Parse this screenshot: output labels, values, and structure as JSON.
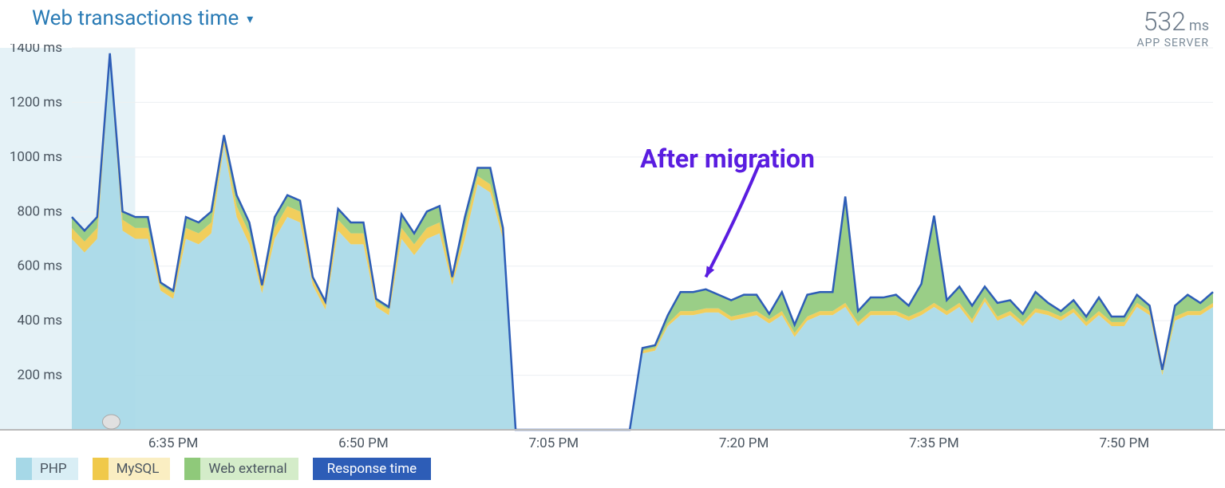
{
  "header": {
    "title": "Web transactions time",
    "stat_value": "532",
    "stat_unit": "ms",
    "stat_label": "APP SERVER"
  },
  "legend": {
    "php": "PHP",
    "mysql": "MySQL",
    "webext": "Web external",
    "resp": "Response time"
  },
  "annotation": "After migration",
  "chart_data": {
    "type": "area",
    "ylabel": "",
    "xlabel": "",
    "ylim": [
      0,
      1400
    ],
    "y_unit": "ms",
    "y_ticks": [
      200,
      400,
      600,
      800,
      1000,
      1200,
      1400
    ],
    "x_ticks": [
      "6:35 PM",
      "6:50 PM",
      "7:05 PM",
      "7:20 PM",
      "7:35 PM",
      "7:50 PM"
    ],
    "x_start": "6:27 PM",
    "x_end": "7:57 PM",
    "x_tick_indices": [
      8,
      23,
      38,
      53,
      68,
      83
    ],
    "categories_minutes_from_start": [
      0,
      1,
      2,
      3,
      4,
      5,
      6,
      7,
      8,
      9,
      10,
      11,
      12,
      13,
      14,
      15,
      16,
      17,
      18,
      19,
      20,
      21,
      22,
      23,
      24,
      25,
      26,
      27,
      28,
      29,
      30,
      31,
      32,
      33,
      34,
      35,
      36,
      37,
      38,
      39,
      40,
      41,
      42,
      43,
      44,
      45,
      46,
      47,
      48,
      49,
      50,
      51,
      52,
      53,
      54,
      55,
      56,
      57,
      58,
      59,
      60,
      61,
      62,
      63,
      64,
      65,
      66,
      67,
      68,
      69,
      70,
      71,
      72,
      73,
      74,
      75,
      76,
      77,
      78,
      79,
      80,
      81,
      82,
      83,
      84,
      85,
      86,
      87,
      88,
      89,
      90
    ],
    "series": [
      {
        "name": "PHP",
        "color": "#a6d8e7",
        "values": [
          700,
          650,
          700,
          1340,
          730,
          700,
          700,
          510,
          480,
          700,
          680,
          720,
          1040,
          780,
          680,
          500,
          700,
          780,
          760,
          530,
          440,
          730,
          680,
          680,
          450,
          420,
          700,
          640,
          700,
          720,
          530,
          700,
          900,
          870,
          700,
          0,
          0,
          0,
          0,
          0,
          0,
          0,
          0,
          0,
          0,
          280,
          290,
          380,
          420,
          420,
          430,
          430,
          400,
          410,
          420,
          390,
          420,
          340,
          400,
          420,
          420,
          450,
          380,
          420,
          420,
          420,
          400,
          420,
          450,
          420,
          450,
          390,
          470,
          400,
          420,
          380,
          430,
          420,
          400,
          430,
          380,
          420,
          380,
          380,
          450,
          420,
          200,
          400,
          420,
          420,
          450
        ]
      },
      {
        "name": "MySQL",
        "color": "#f0c94a",
        "values": [
          40,
          40,
          40,
          20,
          40,
          40,
          40,
          20,
          20,
          40,
          40,
          40,
          20,
          40,
          40,
          20,
          40,
          40,
          40,
          20,
          20,
          40,
          40,
          40,
          20,
          20,
          40,
          40,
          40,
          40,
          20,
          40,
          30,
          30,
          20,
          0,
          0,
          0,
          0,
          0,
          0,
          0,
          0,
          0,
          0,
          10,
          10,
          10,
          15,
          15,
          15,
          15,
          15,
          15,
          15,
          15,
          15,
          15,
          15,
          15,
          15,
          15,
          15,
          15,
          15,
          15,
          15,
          15,
          15,
          15,
          15,
          15,
          15,
          15,
          15,
          15,
          15,
          15,
          15,
          15,
          15,
          15,
          15,
          15,
          15,
          15,
          10,
          15,
          15,
          15,
          15
        ]
      },
      {
        "name": "Web external",
        "color": "#8fc97a",
        "values": [
          40,
          40,
          40,
          20,
          30,
          40,
          40,
          10,
          10,
          40,
          40,
          40,
          20,
          40,
          40,
          10,
          40,
          40,
          40,
          10,
          10,
          40,
          40,
          40,
          10,
          10,
          50,
          40,
          60,
          60,
          10,
          40,
          30,
          60,
          20,
          0,
          0,
          0,
          0,
          0,
          0,
          0,
          0,
          0,
          0,
          10,
          10,
          30,
          70,
          70,
          70,
          50,
          60,
          70,
          60,
          20,
          70,
          30,
          80,
          70,
          70,
          390,
          40,
          50,
          50,
          60,
          40,
          100,
          320,
          40,
          60,
          50,
          40,
          50,
          40,
          30,
          60,
          30,
          20,
          30,
          20,
          50,
          20,
          20,
          30,
          20,
          10,
          40,
          60,
          30,
          40
        ]
      }
    ],
    "response_time": {
      "name": "Response time",
      "color": "#2d5db7",
      "values": [
        780,
        730,
        780,
        1380,
        800,
        780,
        780,
        540,
        510,
        780,
        760,
        800,
        1080,
        860,
        760,
        530,
        780,
        860,
        840,
        560,
        470,
        810,
        760,
        760,
        480,
        450,
        790,
        720,
        800,
        820,
        560,
        780,
        960,
        960,
        740,
        0,
        0,
        0,
        0,
        0,
        0,
        0,
        0,
        0,
        0,
        300,
        310,
        420,
        505,
        505,
        515,
        495,
        475,
        495,
        495,
        425,
        505,
        385,
        495,
        505,
        505,
        855,
        435,
        485,
        485,
        495,
        455,
        535,
        785,
        475,
        525,
        455,
        525,
        465,
        475,
        425,
        505,
        465,
        435,
        475,
        415,
        485,
        415,
        415,
        495,
        455,
        220,
        455,
        495,
        465,
        505
      ]
    },
    "selection": {
      "start_index": 0,
      "end_index": 5
    }
  }
}
